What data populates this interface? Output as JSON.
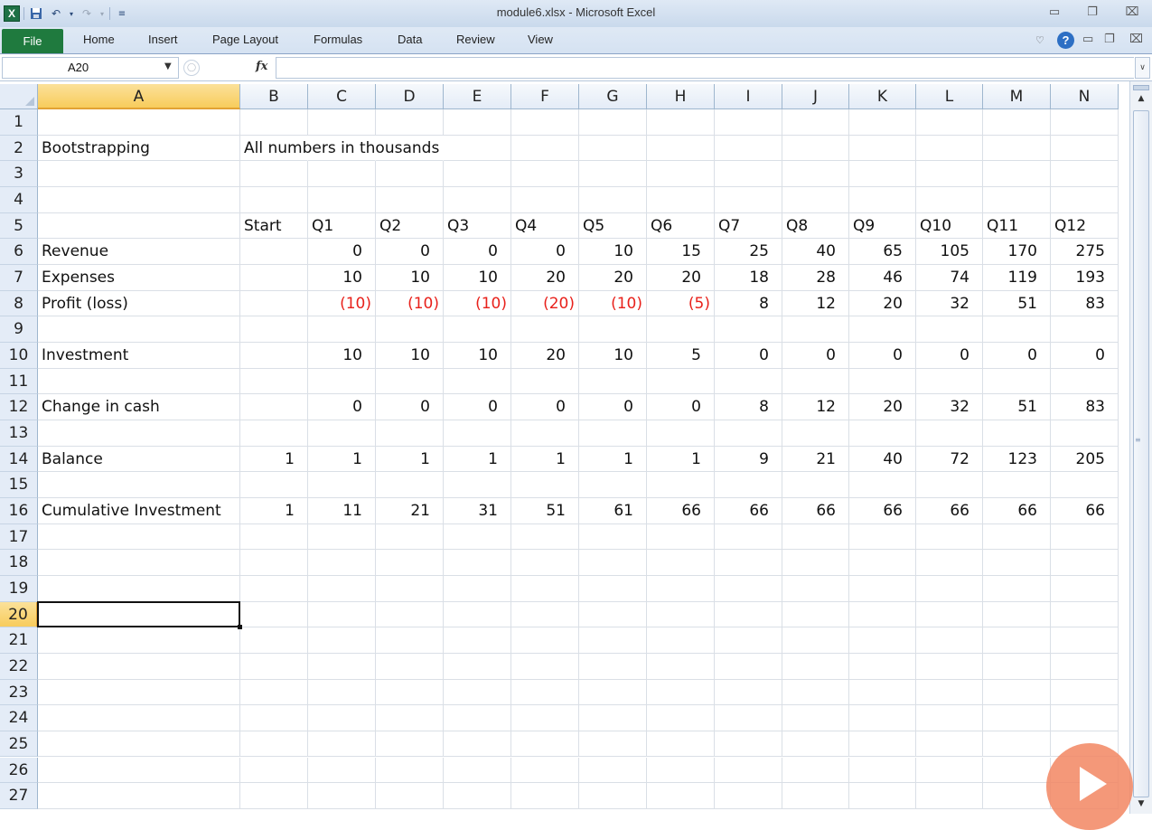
{
  "app": {
    "title": "module6.xlsx - Microsoft Excel",
    "logo_letter": "X",
    "qat_icons": [
      "save-icon",
      "undo-icon",
      "redo-icon",
      "customize-qat-icon"
    ]
  },
  "ribbon": {
    "file_label": "File",
    "tabs": [
      "Home",
      "Insert",
      "Page Layout",
      "Formulas",
      "Data",
      "Review",
      "View"
    ]
  },
  "formula_bar": {
    "name_box": "A20",
    "fx_label": "fx",
    "formula": ""
  },
  "sheet": {
    "columns": [
      "A",
      "B",
      "C",
      "D",
      "E",
      "F",
      "G",
      "H",
      "I",
      "J",
      "K",
      "L",
      "M",
      "N"
    ],
    "rows": [
      "1",
      "2",
      "3",
      "4",
      "5",
      "6",
      "7",
      "8",
      "9",
      "10",
      "11",
      "12",
      "13",
      "14",
      "15",
      "16",
      "17",
      "18",
      "19",
      "20",
      "21",
      "22",
      "23",
      "24",
      "25",
      "26",
      "27"
    ],
    "selected_cell": "A20",
    "cells": [
      {
        "ref": "A2",
        "value": "Bootstrapping"
      },
      {
        "ref": "B2",
        "value": "All numbers in thousands"
      },
      {
        "ref": "B5",
        "value": "Start"
      },
      {
        "ref": "C5",
        "value": "Q1"
      },
      {
        "ref": "D5",
        "value": "Q2"
      },
      {
        "ref": "E5",
        "value": "Q3"
      },
      {
        "ref": "F5",
        "value": "Q4"
      },
      {
        "ref": "G5",
        "value": "Q5"
      },
      {
        "ref": "H5",
        "value": "Q6"
      },
      {
        "ref": "I5",
        "value": "Q7"
      },
      {
        "ref": "J5",
        "value": "Q8"
      },
      {
        "ref": "K5",
        "value": "Q9"
      },
      {
        "ref": "L5",
        "value": "Q10"
      },
      {
        "ref": "M5",
        "value": "Q11"
      },
      {
        "ref": "N5",
        "value": "Q12"
      },
      {
        "ref": "A6",
        "value": "Revenue"
      },
      {
        "ref": "C6",
        "value": "0"
      },
      {
        "ref": "D6",
        "value": "0"
      },
      {
        "ref": "E6",
        "value": "0"
      },
      {
        "ref": "F6",
        "value": "0"
      },
      {
        "ref": "G6",
        "value": "10"
      },
      {
        "ref": "H6",
        "value": "15"
      },
      {
        "ref": "I6",
        "value": "25"
      },
      {
        "ref": "J6",
        "value": "40"
      },
      {
        "ref": "K6",
        "value": "65"
      },
      {
        "ref": "L6",
        "value": "105"
      },
      {
        "ref": "M6",
        "value": "170"
      },
      {
        "ref": "N6",
        "value": "275"
      },
      {
        "ref": "A7",
        "value": "Expenses"
      },
      {
        "ref": "C7",
        "value": "10"
      },
      {
        "ref": "D7",
        "value": "10"
      },
      {
        "ref": "E7",
        "value": "10"
      },
      {
        "ref": "F7",
        "value": "20"
      },
      {
        "ref": "G7",
        "value": "20"
      },
      {
        "ref": "H7",
        "value": "20"
      },
      {
        "ref": "I7",
        "value": "18"
      },
      {
        "ref": "J7",
        "value": "28"
      },
      {
        "ref": "K7",
        "value": "46"
      },
      {
        "ref": "L7",
        "value": "74"
      },
      {
        "ref": "M7",
        "value": "119"
      },
      {
        "ref": "N7",
        "value": "193"
      },
      {
        "ref": "A8",
        "value": "Profit (loss)"
      },
      {
        "ref": "C8",
        "value": "(10)",
        "negative": true
      },
      {
        "ref": "D8",
        "value": "(10)",
        "negative": true
      },
      {
        "ref": "E8",
        "value": "(10)",
        "negative": true
      },
      {
        "ref": "F8",
        "value": "(20)",
        "negative": true
      },
      {
        "ref": "G8",
        "value": "(10)",
        "negative": true
      },
      {
        "ref": "H8",
        "value": "(5)",
        "negative": true
      },
      {
        "ref": "I8",
        "value": "8"
      },
      {
        "ref": "J8",
        "value": "12"
      },
      {
        "ref": "K8",
        "value": "20"
      },
      {
        "ref": "L8",
        "value": "32"
      },
      {
        "ref": "M8",
        "value": "51"
      },
      {
        "ref": "N8",
        "value": "83"
      },
      {
        "ref": "A10",
        "value": "Investment"
      },
      {
        "ref": "C10",
        "value": "10"
      },
      {
        "ref": "D10",
        "value": "10"
      },
      {
        "ref": "E10",
        "value": "10"
      },
      {
        "ref": "F10",
        "value": "20"
      },
      {
        "ref": "G10",
        "value": "10"
      },
      {
        "ref": "H10",
        "value": "5"
      },
      {
        "ref": "I10",
        "value": "0"
      },
      {
        "ref": "J10",
        "value": "0"
      },
      {
        "ref": "K10",
        "value": "0"
      },
      {
        "ref": "L10",
        "value": "0"
      },
      {
        "ref": "M10",
        "value": "0"
      },
      {
        "ref": "N10",
        "value": "0"
      },
      {
        "ref": "A12",
        "value": "Change in cash"
      },
      {
        "ref": "C12",
        "value": "0"
      },
      {
        "ref": "D12",
        "value": "0"
      },
      {
        "ref": "E12",
        "value": "0"
      },
      {
        "ref": "F12",
        "value": "0"
      },
      {
        "ref": "G12",
        "value": "0"
      },
      {
        "ref": "H12",
        "value": "0"
      },
      {
        "ref": "I12",
        "value": "8"
      },
      {
        "ref": "J12",
        "value": "12"
      },
      {
        "ref": "K12",
        "value": "20"
      },
      {
        "ref": "L12",
        "value": "32"
      },
      {
        "ref": "M12",
        "value": "51"
      },
      {
        "ref": "N12",
        "value": "83"
      },
      {
        "ref": "A14",
        "value": "Balance"
      },
      {
        "ref": "B14",
        "value": "1"
      },
      {
        "ref": "C14",
        "value": "1"
      },
      {
        "ref": "D14",
        "value": "1"
      },
      {
        "ref": "E14",
        "value": "1"
      },
      {
        "ref": "F14",
        "value": "1"
      },
      {
        "ref": "G14",
        "value": "1"
      },
      {
        "ref": "H14",
        "value": "1"
      },
      {
        "ref": "I14",
        "value": "9"
      },
      {
        "ref": "J14",
        "value": "21"
      },
      {
        "ref": "K14",
        "value": "40"
      },
      {
        "ref": "L14",
        "value": "72"
      },
      {
        "ref": "M14",
        "value": "123"
      },
      {
        "ref": "N14",
        "value": "205"
      },
      {
        "ref": "A16",
        "value": "Cumulative Investment"
      },
      {
        "ref": "B16",
        "value": "1"
      },
      {
        "ref": "C16",
        "value": "11"
      },
      {
        "ref": "D16",
        "value": "21"
      },
      {
        "ref": "E16",
        "value": "31"
      },
      {
        "ref": "F16",
        "value": "51"
      },
      {
        "ref": "G16",
        "value": "61"
      },
      {
        "ref": "H16",
        "value": "66"
      },
      {
        "ref": "I16",
        "value": "66"
      },
      {
        "ref": "J16",
        "value": "66"
      },
      {
        "ref": "K16",
        "value": "66"
      },
      {
        "ref": "L16",
        "value": "66"
      },
      {
        "ref": "M16",
        "value": "66"
      },
      {
        "ref": "N16",
        "value": "66"
      }
    ]
  },
  "colors": {
    "negative": "#e8211b",
    "file_tab": "#1f7a3e",
    "selection_header": "#f8cc5c",
    "play_overlay": "#f28662"
  }
}
